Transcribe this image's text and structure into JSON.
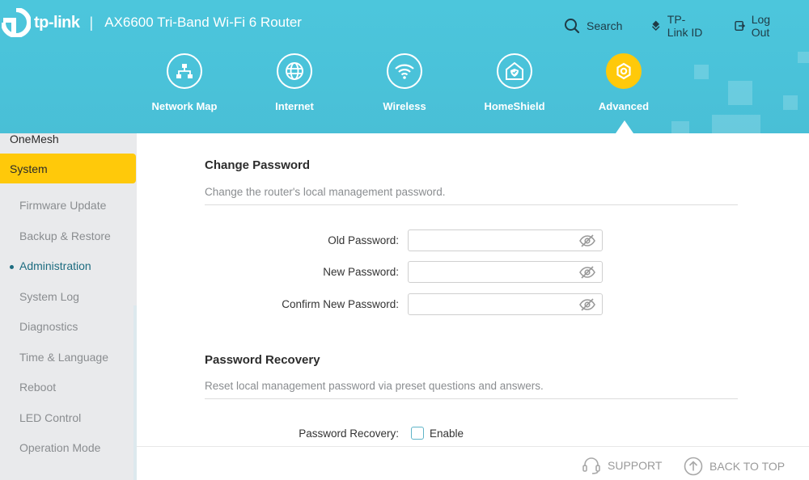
{
  "header": {
    "brand_name": "tp-link",
    "separator": "|",
    "model": "AX6600 Tri-Band Wi-Fi 6 Router",
    "links": {
      "search": "Search",
      "tplink_id": "TP-Link ID",
      "logout": "Log Out"
    }
  },
  "nav": {
    "items": [
      {
        "label": "Network Map",
        "icon": "network-map-icon"
      },
      {
        "label": "Internet",
        "icon": "globe-icon"
      },
      {
        "label": "Wireless",
        "icon": "wifi-icon"
      },
      {
        "label": "HomeShield",
        "icon": "home-shield-icon"
      },
      {
        "label": "Advanced",
        "icon": "gear-icon",
        "active": true
      }
    ]
  },
  "sidebar": {
    "top_item": "OneMesh",
    "section": "System",
    "items": [
      {
        "label": "Firmware Update"
      },
      {
        "label": "Backup & Restore"
      },
      {
        "label": "Administration",
        "active": true
      },
      {
        "label": "System Log"
      },
      {
        "label": "Diagnostics"
      },
      {
        "label": "Time & Language"
      },
      {
        "label": "Reboot"
      },
      {
        "label": "LED Control"
      },
      {
        "label": "Operation Mode"
      }
    ]
  },
  "change_password": {
    "title": "Change Password",
    "description": "Change the router's local management password.",
    "old_label": "Old Password:",
    "new_label": "New Password:",
    "confirm_label": "Confirm New Password:",
    "old_value": "",
    "new_value": "",
    "confirm_value": ""
  },
  "password_recovery": {
    "title": "Password Recovery",
    "description": "Reset local management password via preset questions and answers.",
    "label": "Password Recovery:",
    "checkbox_label": "Enable",
    "enabled": false
  },
  "footer": {
    "support": "SUPPORT",
    "back_to_top": "BACK TO TOP"
  },
  "colors": {
    "accent": "#ffc90a",
    "header_bg": "#4cc6dc",
    "active_text": "#1d6c80"
  }
}
